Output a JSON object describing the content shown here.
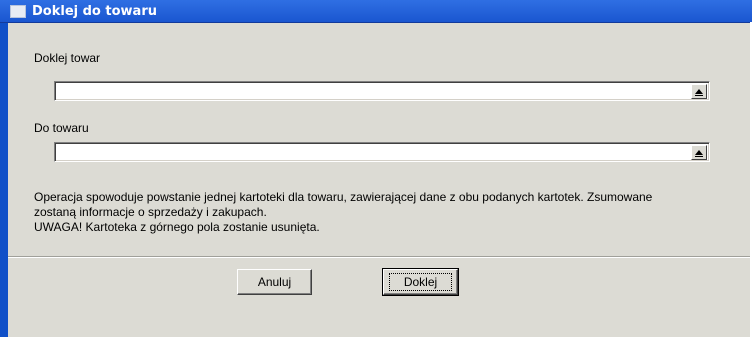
{
  "window": {
    "title": "Doklej do towaru"
  },
  "fields": {
    "source": {
      "label": "Doklej towar",
      "value": ""
    },
    "target": {
      "label": "Do towaru",
      "value": ""
    }
  },
  "info": {
    "line1": "Operacja spowoduje powstanie jednej kartoteki dla towaru, zawierającej dane z obu podanych kartotek. Zsumowane",
    "line2": "zostaną informacje o sprzedaży i zakupach.",
    "line3": "UWAGA! Kartoteka z górnego pola zostanie usunięta."
  },
  "buttons": {
    "cancel": "Anuluj",
    "ok": "Doklej"
  }
}
